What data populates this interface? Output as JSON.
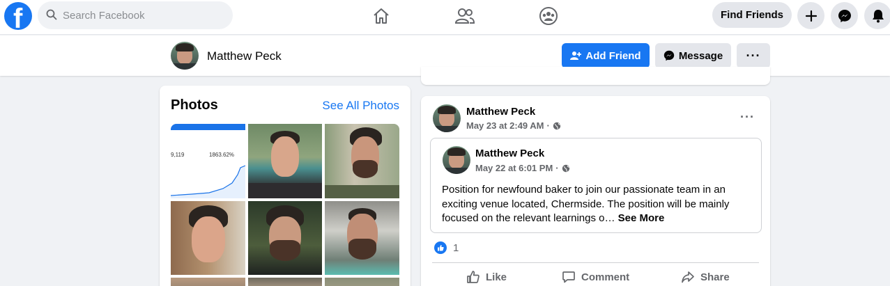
{
  "nav": {
    "search_placeholder": "Search Facebook",
    "find_friends": "Find Friends",
    "logo_letter": "f"
  },
  "profile": {
    "name": "Matthew Peck",
    "add_friend": "Add Friend",
    "message": "Message",
    "more": "···"
  },
  "photos": {
    "title": "Photos",
    "see_all": "See All Photos",
    "chart_thumb": {
      "left_value": "9,119",
      "right_value": "1863.62%"
    }
  },
  "post": {
    "author": "Matthew Peck",
    "time": "May 23 at 2:49 AM",
    "separator": "·",
    "more": "···",
    "shared": {
      "author": "Matthew Peck",
      "time": "May 22 at 6:01 PM",
      "text": "Position for newfound baker to join our passionate team in an exciting venue located, Chermside. The position will be mainly focused on the relevant learnings o…",
      "see_more": "See More"
    },
    "reaction_count": "1",
    "actions": {
      "like": "Like",
      "comment": "Comment",
      "share": "Share"
    }
  },
  "colors": {
    "brand": "#1877f2",
    "page_bg": "#f0f2f5",
    "secondary_text": "#65676b"
  }
}
